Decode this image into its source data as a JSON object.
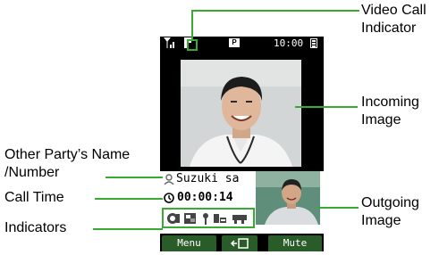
{
  "status_bar": {
    "time": "10:00",
    "center_icon": "P",
    "signal_icon": "signal-antenna-icon",
    "video_call_icon": "video-call-icon",
    "battery_icon": "battery-icon"
  },
  "call": {
    "name": "Suzuki sa",
    "time": "00:00:14"
  },
  "indicators": [
    "indicator-1-icon",
    "indicator-2-icon",
    "indicator-3-icon",
    "indicator-4-icon",
    "indicator-5-icon"
  ],
  "softkeys": {
    "left": "Menu",
    "center_icon": "camera-switch-icon",
    "right": "Mute"
  },
  "callouts": {
    "video_call_line1": "Video Call",
    "video_call_line2": "Indicator",
    "incoming_line1": "Incoming",
    "incoming_line2": "Image",
    "party_line1": "Other Party’s Name",
    "party_line2": "/Number",
    "call_time": "Call Time",
    "indicators": "Indicators",
    "outgoing_line1": "Outgoing",
    "outgoing_line2": "Image"
  },
  "colors": {
    "callout_line": "#3aaa35",
    "softkey_bg": "#2a5c2a",
    "screen_bg": "#000000"
  }
}
